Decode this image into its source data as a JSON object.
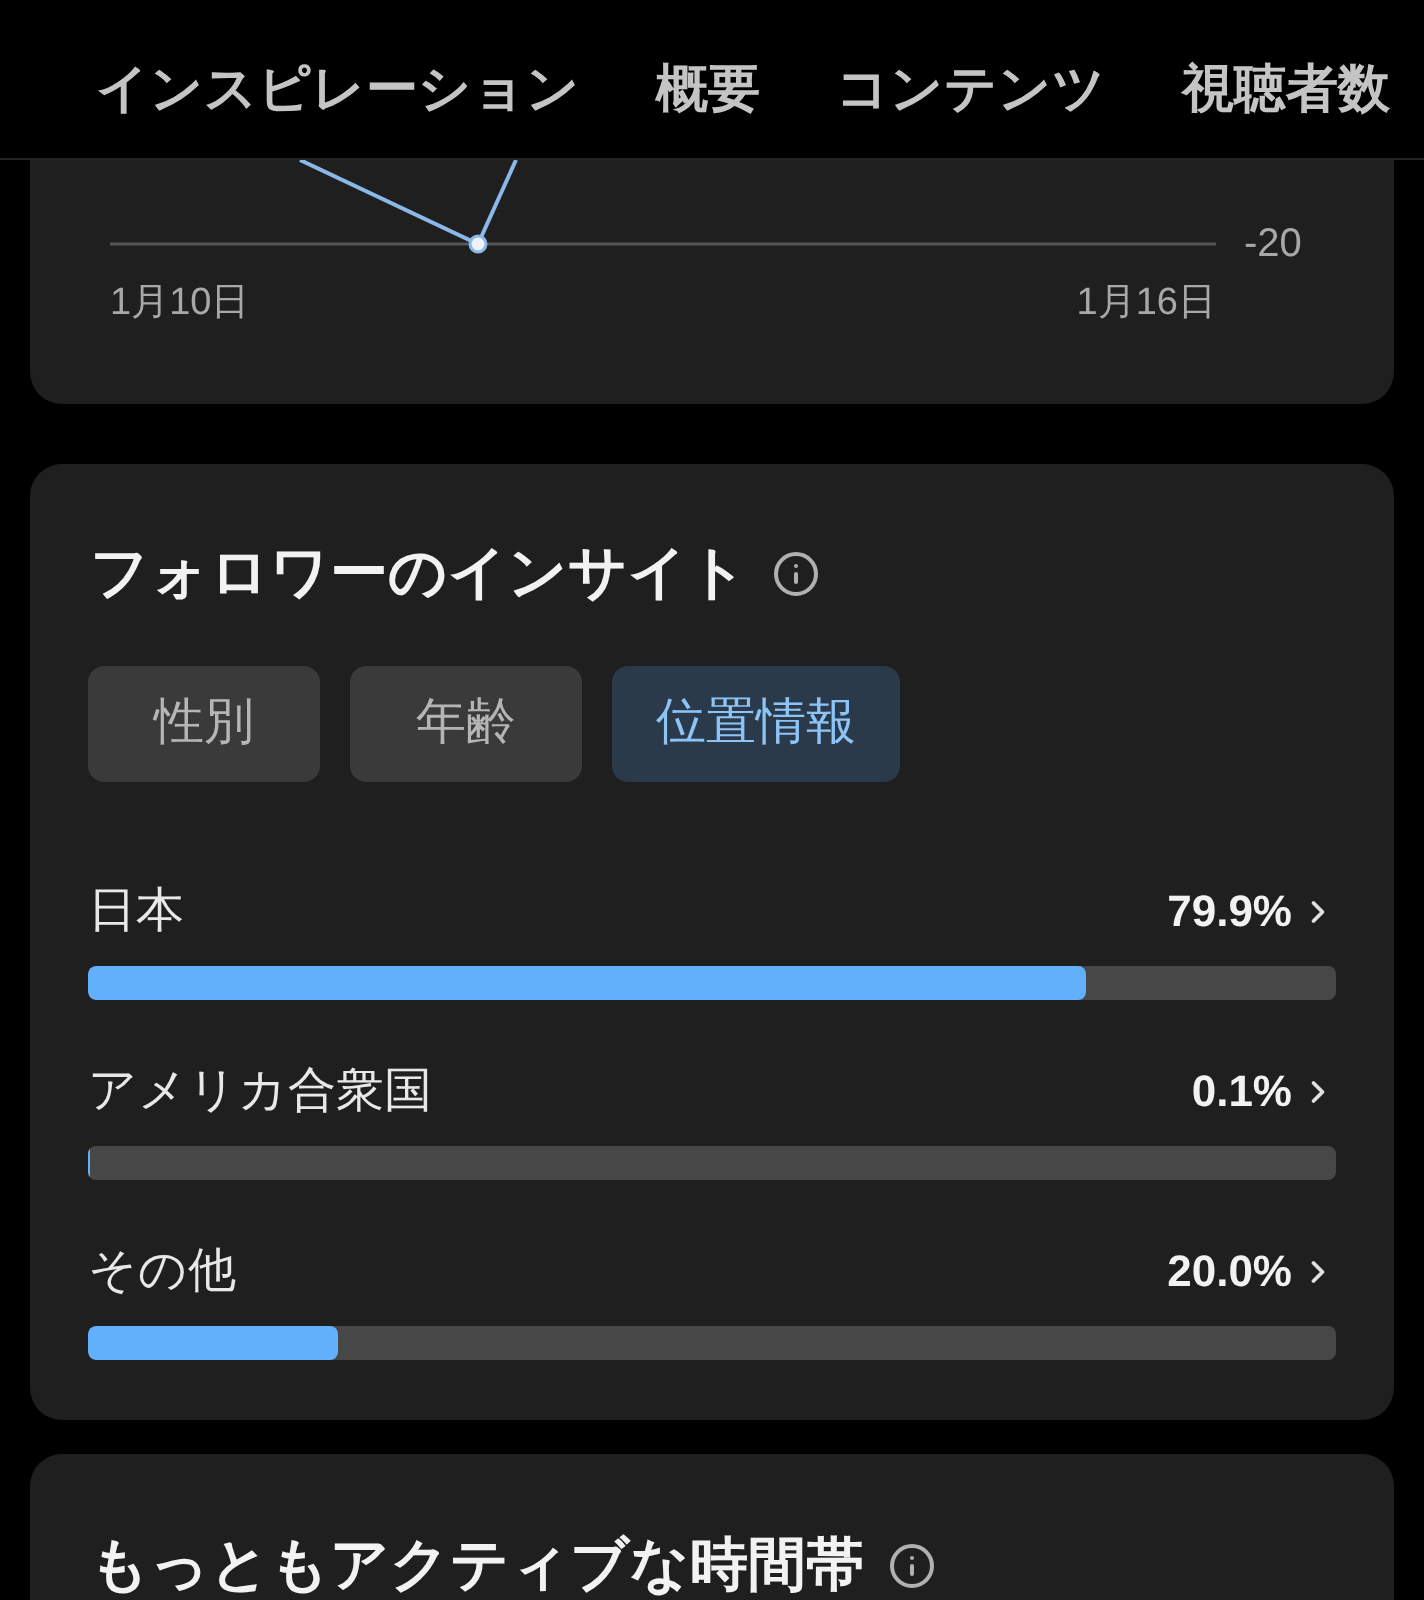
{
  "nav_tabs": [
    {
      "label": "インスピレーション"
    },
    {
      "label": "概要"
    },
    {
      "label": "コンテンツ"
    },
    {
      "label": "視聴者数"
    }
  ],
  "trend_chart": {
    "y_tick": "-20",
    "x_labels": [
      "1月10日",
      "1月16日"
    ]
  },
  "follower_insights": {
    "title": "フォロワーのインサイト",
    "filters": [
      {
        "label": "性別",
        "selected": false
      },
      {
        "label": "年齢",
        "selected": false
      },
      {
        "label": "位置情報",
        "selected": true
      }
    ],
    "locations": [
      {
        "name": "日本",
        "percent": "79.9%",
        "level": 0.799
      },
      {
        "name": "アメリカ合衆国",
        "percent": "0.1%",
        "level": 0.001
      },
      {
        "name": "その他",
        "percent": "20.0%",
        "level": 0.2
      }
    ]
  },
  "active_times": {
    "title": "もっともアクティブな時間帯"
  }
}
